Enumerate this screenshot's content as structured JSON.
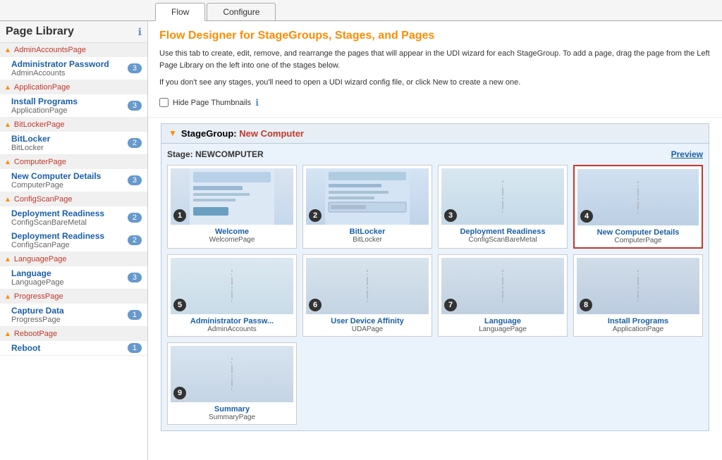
{
  "app": {
    "title": "Page Library"
  },
  "tabs": [
    {
      "id": "flow",
      "label": "Flow",
      "active": true
    },
    {
      "id": "configure",
      "label": "Configure",
      "active": false
    }
  ],
  "flow": {
    "title_prefix": "Flow Designer for ",
    "title_highlight": "StageGroups, Stages, and Pages",
    "description1": "Use this tab to create, edit, remove, and rearrange the pages that will appear in the UDI wizard for each StageGroup. To add a page, drag the page from the Left Page Library on the left into one of the stages below.",
    "description2": "If you don't see any stages, you'll need to open a UDI wizard config file, or click New to create a new one.",
    "hide_thumbnails_label": "Hide Page Thumbnails",
    "stage_group_label": "StageGroup:",
    "stage_group_name": "New Computer",
    "stage_label": "Stage: NEWCOMPUTER",
    "preview_label": "Preview"
  },
  "sidebar": {
    "title": "Page Library",
    "groups": [
      {
        "id": "AdminAccountsPage",
        "name": "AdminAccountsPage",
        "items": [
          {
            "title": "Administrator Password",
            "sub": "AdminAccounts",
            "badge": "3"
          }
        ]
      },
      {
        "id": "ApplicationPage",
        "name": "ApplicationPage",
        "items": [
          {
            "title": "Install Programs",
            "sub": "ApplicationPage",
            "badge": "3"
          }
        ]
      },
      {
        "id": "BitLockerPage",
        "name": "BitLockerPage",
        "items": [
          {
            "title": "BitLocker",
            "sub": "BitLocker",
            "badge": "2"
          }
        ]
      },
      {
        "id": "ComputerPage",
        "name": "ComputerPage",
        "items": [
          {
            "title": "New Computer Details",
            "sub": "ComputerPage",
            "badge": "3"
          }
        ]
      },
      {
        "id": "ConfigScanPage",
        "name": "ConfigScanPage",
        "items": [
          {
            "title": "Deployment Readiness",
            "sub": "ConfigScanBareMetal",
            "badge": "2"
          },
          {
            "title": "Deployment Readiness",
            "sub": "ConfigScanPage",
            "badge": "2"
          }
        ]
      },
      {
        "id": "LanguagePage",
        "name": "LanguagePage",
        "items": [
          {
            "title": "Language",
            "sub": "LanguagePage",
            "badge": "3"
          }
        ]
      },
      {
        "id": "ProgressPage",
        "name": "ProgressPage",
        "items": [
          {
            "title": "Capture Data",
            "sub": "ProgressPage",
            "badge": "1"
          }
        ]
      },
      {
        "id": "RebootPage",
        "name": "RebootPage",
        "items": [
          {
            "title": "Reboot",
            "sub": "",
            "badge": "1"
          }
        ]
      }
    ]
  },
  "pages": [
    {
      "number": "1",
      "title": "Welcome",
      "sub": "WelcomePage",
      "selected": false,
      "thumb": "welcome"
    },
    {
      "number": "2",
      "title": "BitLocker",
      "sub": "BitLocker",
      "selected": false,
      "thumb": "bitlocker"
    },
    {
      "number": "3",
      "title": "Deployment Readiness",
      "sub": "ConfigScanBareMetal",
      "selected": false,
      "thumb": "deployment"
    },
    {
      "number": "4",
      "title": "New Computer Details",
      "sub": "ComputerPage",
      "selected": true,
      "thumb": "newcomputer"
    },
    {
      "number": "5",
      "title": "Administrator Passw...",
      "sub": "AdminAccounts",
      "selected": false,
      "thumb": "adminpass"
    },
    {
      "number": "6",
      "title": "User Device Affinity",
      "sub": "UDAPage",
      "selected": false,
      "thumb": "userdevice"
    },
    {
      "number": "7",
      "title": "Language",
      "sub": "LanguagePage",
      "selected": false,
      "thumb": "language"
    },
    {
      "number": "8",
      "title": "Install Programs",
      "sub": "ApplicationPage",
      "selected": false,
      "thumb": "install"
    },
    {
      "number": "9",
      "title": "Summary",
      "sub": "SummaryPage",
      "selected": false,
      "thumb": "summary"
    }
  ]
}
